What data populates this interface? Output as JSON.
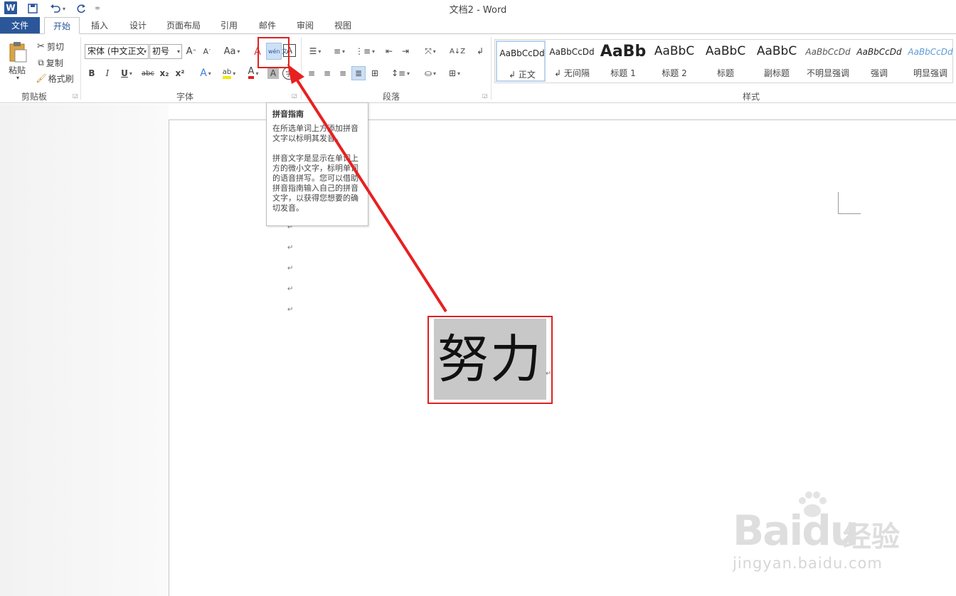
{
  "title": "文档2 - Word",
  "quick_access": {
    "app_icon": "W",
    "save_icon": "save-icon",
    "undo_icon": "undo-icon",
    "redo_icon": "redo-icon"
  },
  "tabs": [
    {
      "label": "文件"
    },
    {
      "label": "开始"
    },
    {
      "label": "插入"
    },
    {
      "label": "设计"
    },
    {
      "label": "页面布局"
    },
    {
      "label": "引用"
    },
    {
      "label": "邮件"
    },
    {
      "label": "审阅"
    },
    {
      "label": "视图"
    }
  ],
  "clipboard": {
    "paste": "粘贴",
    "cut": "剪切",
    "copy": "复制",
    "format_painter": "格式刷",
    "group": "剪贴板"
  },
  "font": {
    "font_name": "宋体 (中文正文",
    "font_size": "初号",
    "grow": "A",
    "shrink": "A",
    "change_case": "Aa",
    "bold": "B",
    "italic": "I",
    "underline": "U",
    "strike": "abc",
    "subscript": "x₂",
    "superscript": "x²",
    "text_effects": "A",
    "highlight": "ab",
    "font_color": "A",
    "char_shading": "A",
    "phonetic": "wén 文",
    "char_border": "A",
    "enclose": "字",
    "group": "字体"
  },
  "paragraph": {
    "group": "段落"
  },
  "styles": {
    "group": "样式",
    "items": [
      {
        "preview": "AaBbCcDd",
        "name": "正文"
      },
      {
        "preview": "AaBbCcDd",
        "name": "无间隔"
      },
      {
        "preview": "AaBb",
        "name": "标题 1"
      },
      {
        "preview": "AaBbC",
        "name": "标题 2"
      },
      {
        "preview": "AaBbC",
        "name": "标题"
      },
      {
        "preview": "AaBbC",
        "name": "副标题"
      },
      {
        "preview": "AaBbCcDd",
        "name": "不明显强调"
      },
      {
        "preview": "AaBbCcDd",
        "name": "强调"
      },
      {
        "preview": "AaBbCcDd",
        "name": "明显强调"
      }
    ]
  },
  "tooltip": {
    "title": "拼音指南",
    "body1": "在所选单词上方添加拼音文字以标明其发音。",
    "body2": "拼音文字是显示在单词上方的微小文字，标明单词的语音拼写。您可以借助拼音指南输入自己的拼音文字，以获得您想要的确切发音。"
  },
  "document": {
    "selected_text": "努力",
    "para_mark": "↵"
  },
  "watermark": {
    "logo": "Baidu",
    "cn": "经验",
    "url": "jingyan.baidu.com"
  }
}
